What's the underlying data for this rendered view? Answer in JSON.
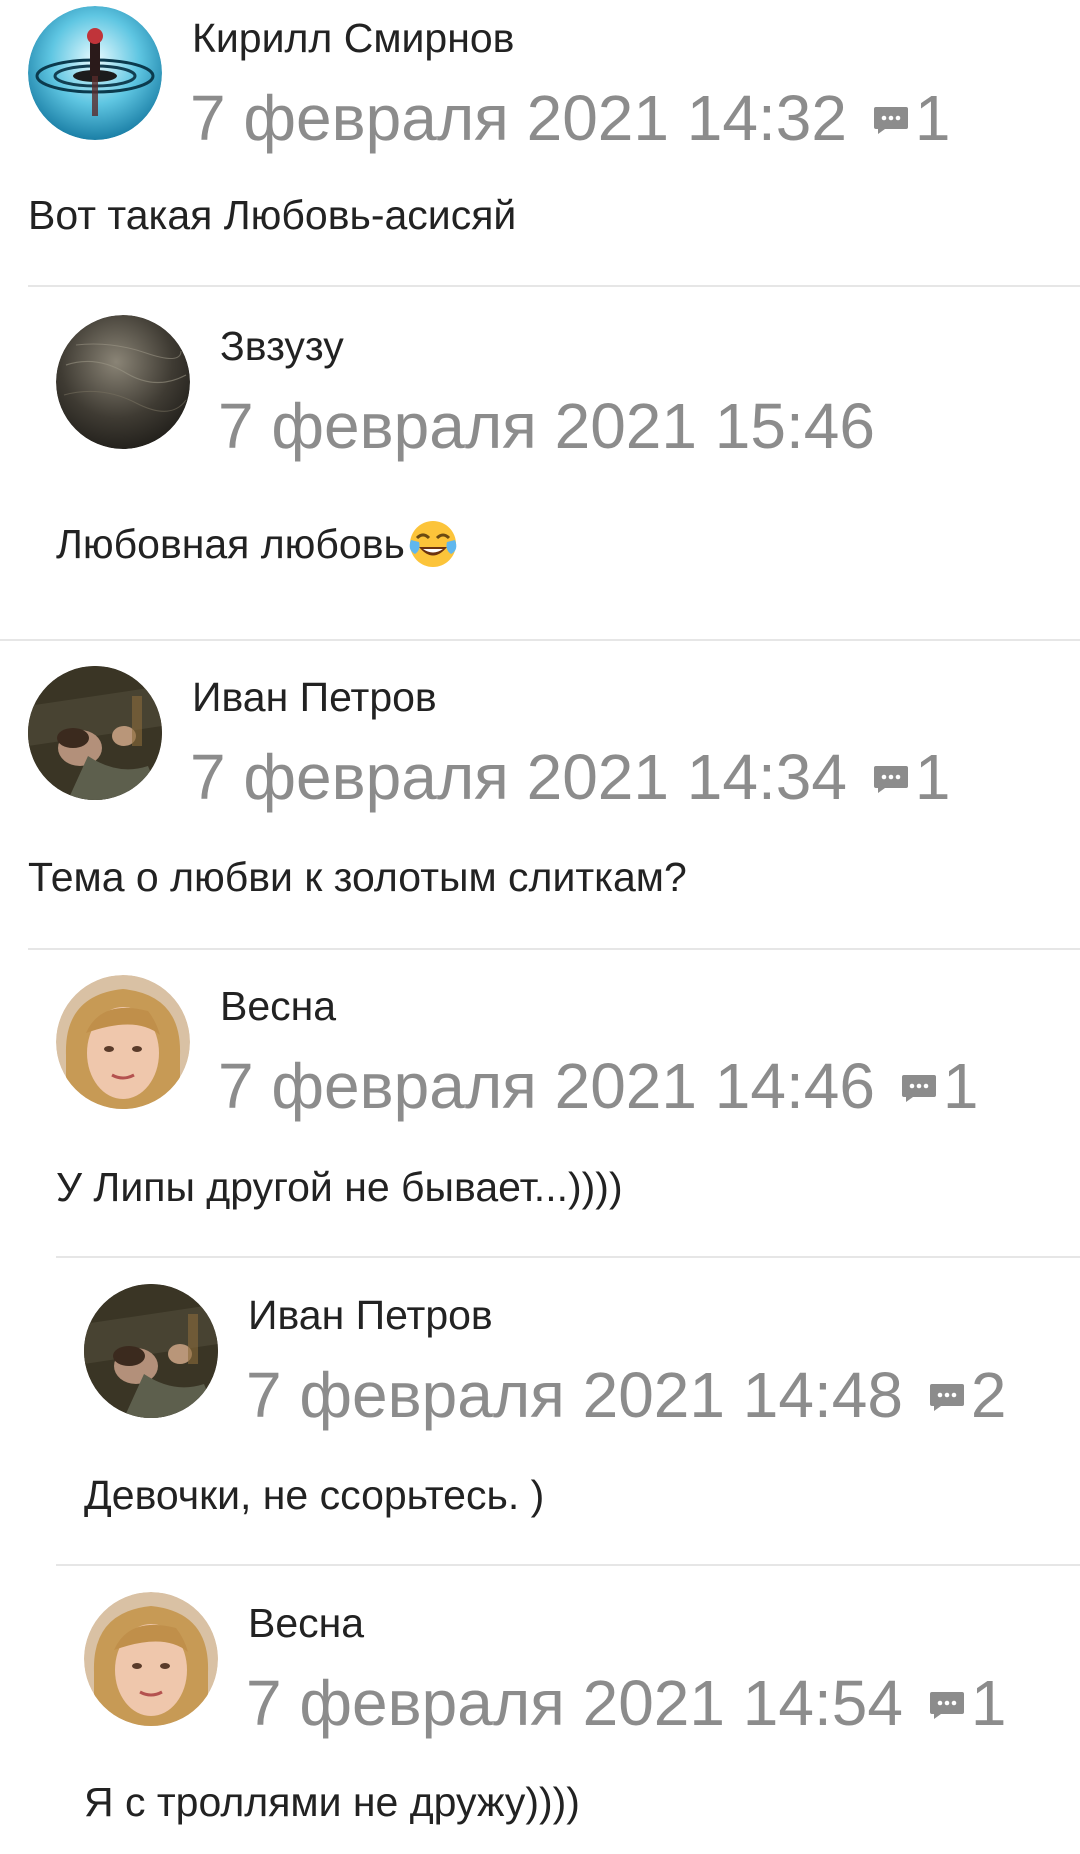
{
  "comments": [
    {
      "author": "Кирилл Смирнов",
      "date": "7 февраля 2021 14:32",
      "reply_count": "1",
      "text": "Вот такая Любовь-асисяй",
      "avatar": "water-drop-avatar"
    },
    {
      "author": "Звзузу",
      "date": "7 февраля 2021 15:46",
      "reply_count": "",
      "text": "Любовная любовь",
      "emoji": "tears-of-joy-emoji",
      "avatar": "dark-texture-avatar"
    },
    {
      "author": "Иван Петров",
      "date": "7 февраля 2021 14:34",
      "reply_count": "1",
      "text": "Тема о любви к золотым слиткам?",
      "avatar": "man-lying-avatar"
    },
    {
      "author": "Весна",
      "date": "7 февраля 2021 14:46",
      "reply_count": "1",
      "text": "У Липы другой не бывает...))))",
      "avatar": "woman-face-avatar"
    },
    {
      "author": "Иван Петров",
      "date": "7 февраля 2021 14:48",
      "reply_count": "2",
      "text": "Девочки, не ссорьтесь. )",
      "avatar": "man-lying-avatar"
    },
    {
      "author": "Весна",
      "date": "7 февраля 2021 14:54",
      "reply_count": "1",
      "text": "Я с троллями не дружу))))",
      "avatar": "woman-face-avatar"
    }
  ],
  "icons": {
    "reply": "comment-bubble-icon"
  },
  "colors": {
    "text": "#222222",
    "meta": "#8c8c8c",
    "divider": "#e6e6e6"
  }
}
